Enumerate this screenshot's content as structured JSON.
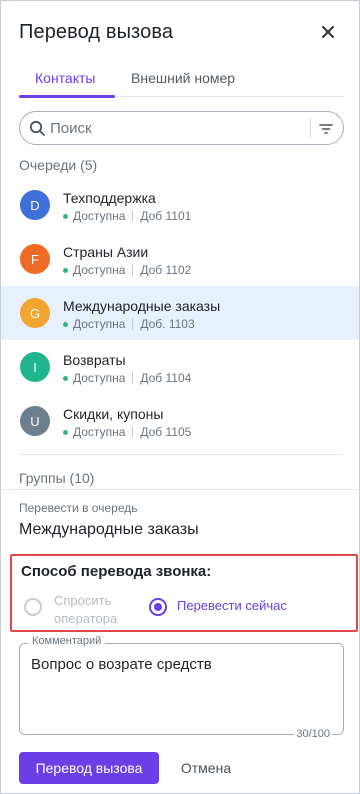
{
  "header": {
    "title": "Перевод вызова",
    "close_icon": "close-icon"
  },
  "tabs": [
    {
      "label": "Контакты",
      "active": true
    },
    {
      "label": "Внешний номер",
      "active": false
    }
  ],
  "search": {
    "placeholder": "Поиск",
    "value": "",
    "icon": "search-icon",
    "filter_icon": "filter-icon"
  },
  "queues": {
    "label": "Очереди (5)",
    "items": [
      {
        "initial": "D",
        "name": "Техподдержка",
        "status": "Доступна",
        "ext": "Доб 1101",
        "color": "#3f6fd8",
        "selected": false
      },
      {
        "initial": "F",
        "name": "Страны Азии",
        "status": "Доступна",
        "ext": "Доб 1102",
        "color": "#ef6a26",
        "selected": false
      },
      {
        "initial": "G",
        "name": "Международные заказы",
        "status": "Доступна",
        "ext": "Доб. 1103",
        "color": "#f2a531",
        "selected": true
      },
      {
        "initial": "I",
        "name": "Возвраты",
        "status": "Доступна",
        "ext": "Доб 1104",
        "color": "#21b58e",
        "selected": false
      },
      {
        "initial": "U",
        "name": "Скидки, купоны",
        "status": "Доступна",
        "ext": "Доб 1105",
        "color": "#6b7f8c",
        "selected": false
      }
    ]
  },
  "groups": {
    "label": "Группы (10)"
  },
  "transfer": {
    "label": "Перевести в очередь",
    "value": "Международные заказы"
  },
  "method": {
    "title": "Способ перевода звонка:",
    "options": [
      {
        "label": "Спросить оператора",
        "selected": false,
        "disabled": true
      },
      {
        "label": "Перевести сейчас",
        "selected": true,
        "disabled": false
      }
    ]
  },
  "comment": {
    "label": "Комментарий",
    "value": "Вопрос о возрате средств",
    "counter": "30/100"
  },
  "footer": {
    "primary_label": "Перевод вызова",
    "cancel_label": "Отмена"
  },
  "colors": {
    "accent": "#6a3fe6",
    "status_available": "#2cb67d",
    "selected_row": "#e8f0fb",
    "highlight_border": "#e0484c"
  }
}
